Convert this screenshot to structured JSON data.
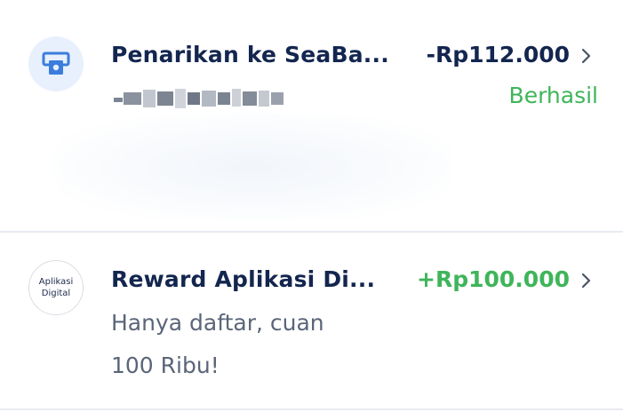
{
  "transactions": [
    {
      "title": "Penarikan ke SeaBa...",
      "amount": "-Rp112.000",
      "status": "Berhasil",
      "icon": "atm-withdraw-icon"
    },
    {
      "title": "Reward Aplikasi Di...",
      "amount": "+Rp100.000",
      "description_line1": "Hanya daftar, cuan",
      "description_line2": "100 Ribu!",
      "logo_line1": "Aplikasi",
      "logo_line2": "Digital"
    }
  ],
  "colors": {
    "title": "#13264f",
    "positive": "#3fb55a",
    "muted": "#5b6579",
    "icon_bg": "#e7f0fc",
    "icon_fg": "#3b7ddd"
  }
}
